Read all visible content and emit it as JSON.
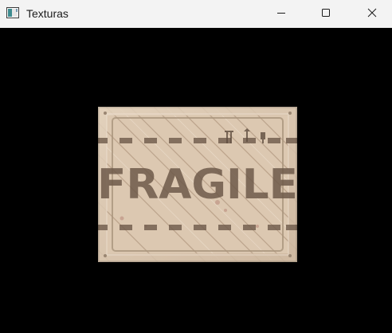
{
  "window": {
    "title": "Texturas",
    "app_icon": "app-window-icon",
    "controls": {
      "minimize_icon": "minimize-icon",
      "maximize_icon": "maximize-icon",
      "close_icon": "close-icon"
    }
  },
  "viewport": {
    "background": "#000000",
    "texture": {
      "label": "FRAGILE",
      "base_color": "#d9c5ad",
      "stripe_color": "#6e5a4a"
    }
  }
}
